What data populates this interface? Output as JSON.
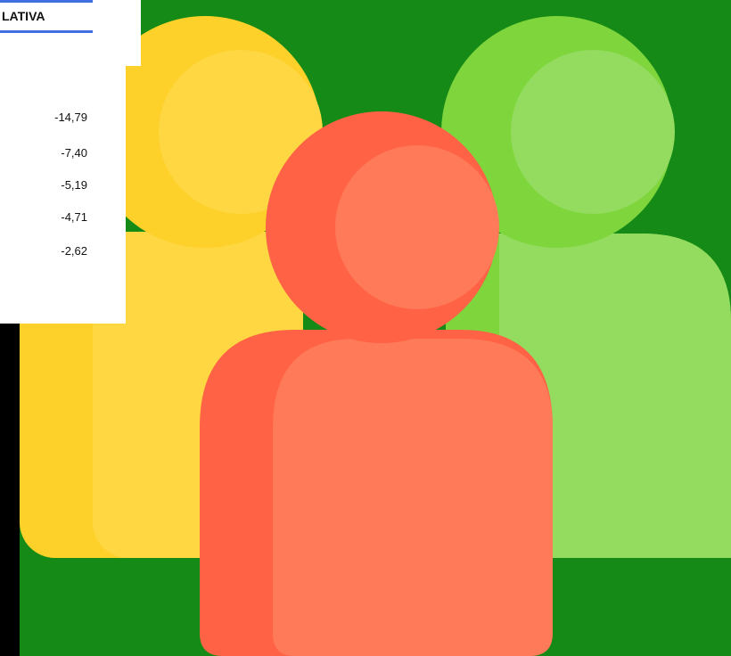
{
  "table": {
    "header": "LATIVA",
    "values": [
      "-14,79",
      "-7,40",
      "-5,19",
      "-4,71",
      "-2,62"
    ]
  },
  "colors": {
    "background": "#168a17",
    "yellow_dark": "#fdd12a",
    "yellow_light": "#ffd743",
    "green_dark": "#7fd63c",
    "green_light": "#93dc5f",
    "red_dark": "#ff6245",
    "red_light": "#ff7a58",
    "accent_line": "#3f6fe0"
  },
  "icons": [
    "people-group-icon"
  ]
}
